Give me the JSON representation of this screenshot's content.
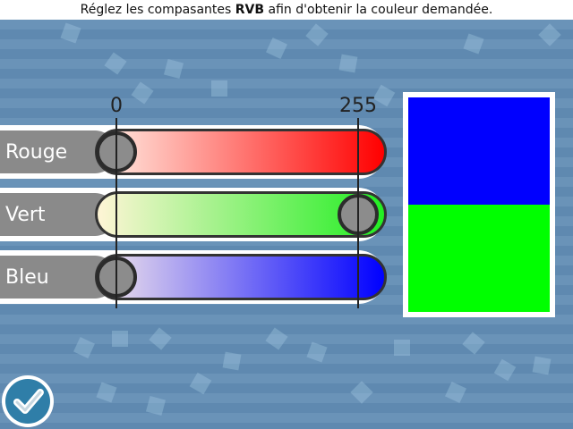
{
  "instruction": {
    "before": "Réglez les compasantes ",
    "emphasis": "RVB",
    "after": " afin d'obtenir la couleur demandée."
  },
  "scale": {
    "min_label": "0",
    "max_label": "255"
  },
  "sliders": [
    {
      "label": "Rouge",
      "value": 0,
      "gradient_from": "#ffefe6",
      "gradient_to": "#ff0000"
    },
    {
      "label": "Vert",
      "value": 255,
      "gradient_from": "#fff5d6",
      "gradient_to": "#22ee22"
    },
    {
      "label": "Bleu",
      "value": 0,
      "gradient_from": "#f3e6ea",
      "gradient_to": "#0000ff"
    }
  ],
  "target_color": "#0000ff",
  "current_color": "#00ff00",
  "validate_icon": "check-icon"
}
